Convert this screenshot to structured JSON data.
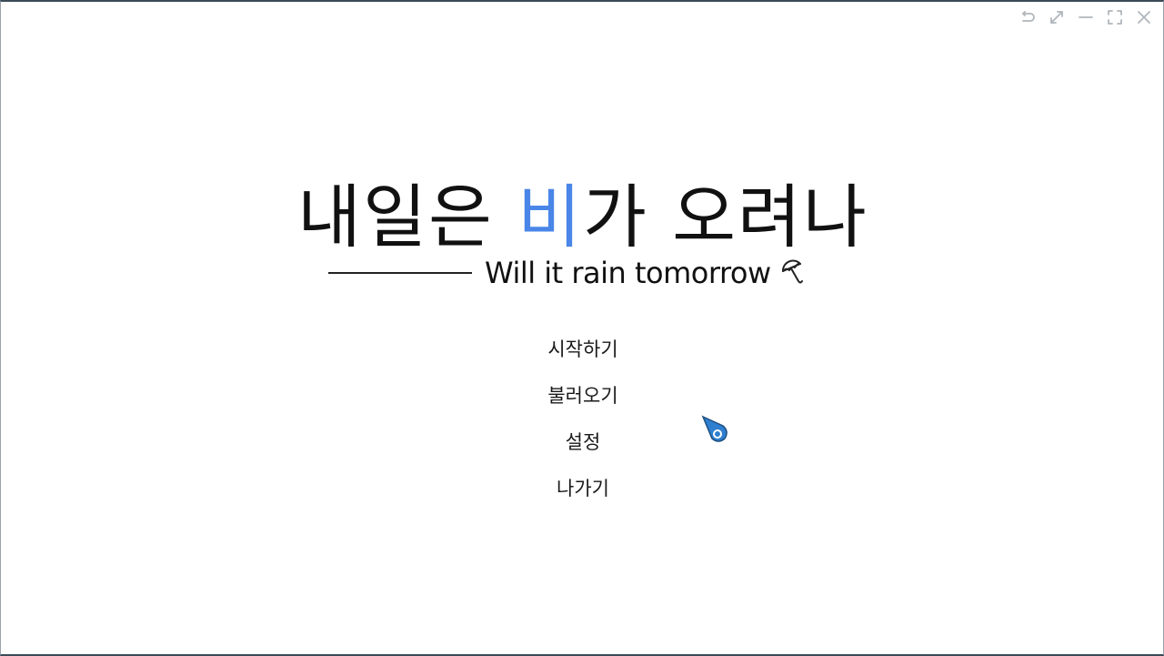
{
  "window": {
    "controls": [
      "restore-icon",
      "expand-icon",
      "minimize-icon",
      "fullscreen-icon",
      "close-icon"
    ]
  },
  "title": {
    "before_accent": "내일은 ",
    "accent": "비",
    "after_accent": "가 오려나",
    "accent_color": "#4a86e8"
  },
  "subtitle": {
    "text": "Will it rain tomorrow",
    "icon": "umbrella-icon"
  },
  "menu": {
    "items": [
      {
        "label": "시작하기"
      },
      {
        "label": "불러오기"
      },
      {
        "label": "설정"
      },
      {
        "label": "나가기"
      }
    ]
  },
  "cursor": {
    "icon": "pointer-cursor-icon",
    "color": "#2f7fd0"
  }
}
